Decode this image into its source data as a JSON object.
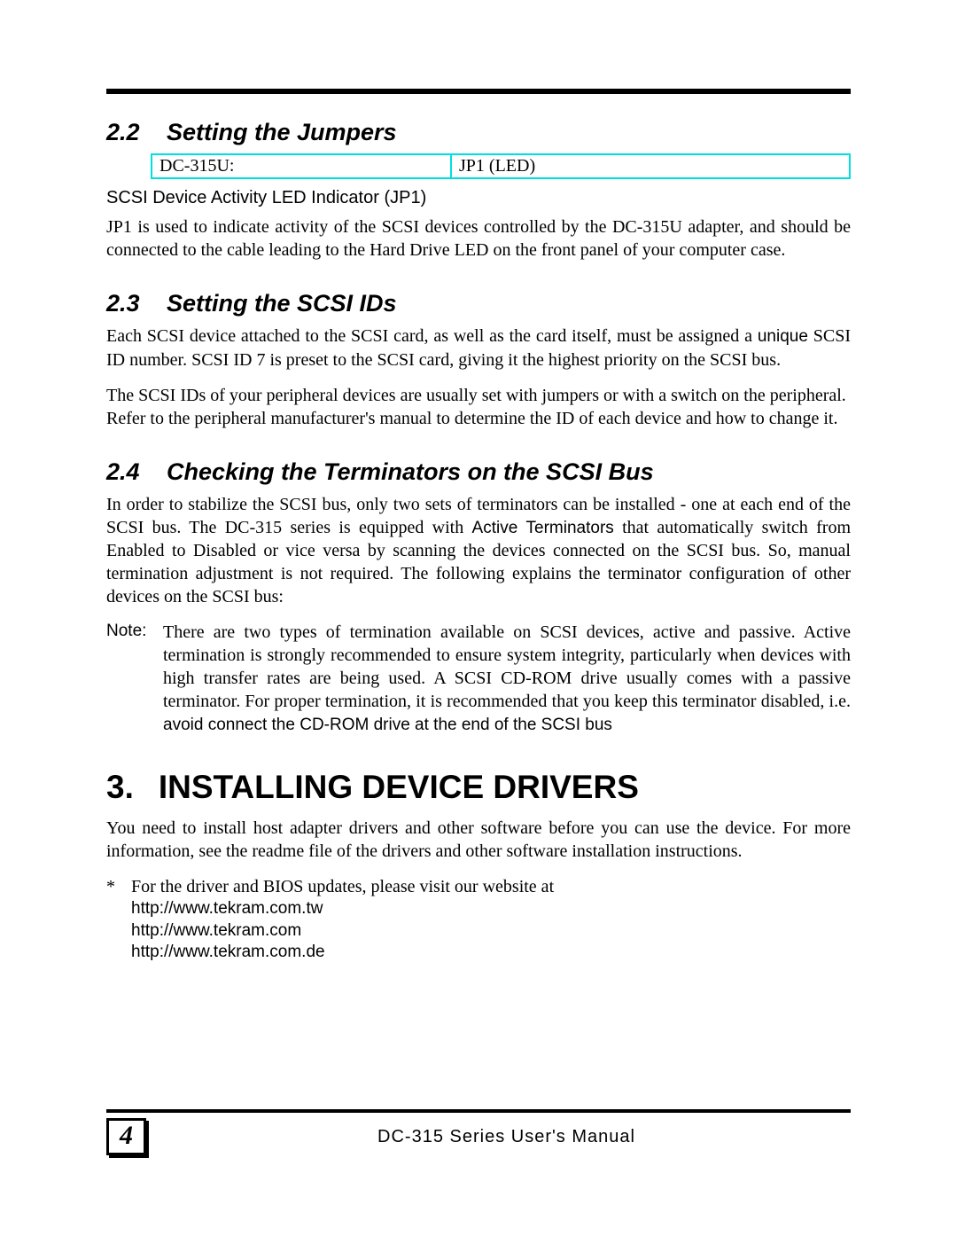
{
  "section22": {
    "num": "2.2",
    "title": "Setting the Jumpers",
    "table": {
      "left": "DC-315U:",
      "right": "JP1 (LED)"
    },
    "subheading": "SCSI Device Activity LED Indicator (JP1)",
    "para1": "JP1 is used to indicate activity of the SCSI devices controlled by the DC-315U adapter, and should be connected to the cable leading to the Hard Drive LED on the front panel of your computer case."
  },
  "section23": {
    "num": "2.3",
    "title": "Setting the SCSI IDs",
    "para1_a": "Each SCSI device attached to the SCSI card, as well as the card itself, must be assigned a ",
    "para1_u": "unique",
    "para1_b": " SCSI ID number. SCSI ID 7 is preset to the SCSI card, giving it the highest priority on the SCSI bus.",
    "para2": "The SCSI IDs of your peripheral devices are usually set with jumpers or with a switch on the peripheral. Refer to the peripheral manufacturer's manual to determine the ID of each device and how to change it."
  },
  "section24": {
    "num": "2.4",
    "title": "Checking the Terminators on the SCSI Bus",
    "para1_a": "In order to stabilize the SCSI bus, only two sets of terminators can be installed - one at each end of the SCSI bus. The DC-315 series is equipped with ",
    "para1_at": "Active Terminators",
    "para1_b": " that automatically switch from Enabled to Disabled or vice versa by scanning the devices connected on the SCSI bus. So, manual termination adjustment is not required. The following explains the terminator configuration of other devices on the SCSI bus:",
    "note_label": "Note:",
    "note_a": "There are two types of termination available on SCSI devices, active and passive. Active termination is strongly recommended to ensure system integrity, particularly when devices with high transfer rates are being used. A SCSI CD-ROM drive usually comes with a passive terminator. For proper termination, it is recommended that you keep this terminator disabled, i.e. ",
    "note_em": "avoid connect the CD-ROM drive at the end of the SCSI bus"
  },
  "section3": {
    "num": "3.",
    "title": "INSTALLING DEVICE DRIVERS",
    "para1": "You need to install host adapter drivers and other software before you can use the device. For more information, see the readme file of the drivers and other software installation instructions.",
    "bullet_mark": "*",
    "bullet_text": "For the driver and BIOS updates, please visit our website at",
    "links": [
      "http://www.tekram.com.tw",
      "http://www.tekram.com",
      "http://www.tekram.com.de"
    ]
  },
  "footer": {
    "page": "4",
    "text": "DC-315 Series User's Manual"
  }
}
